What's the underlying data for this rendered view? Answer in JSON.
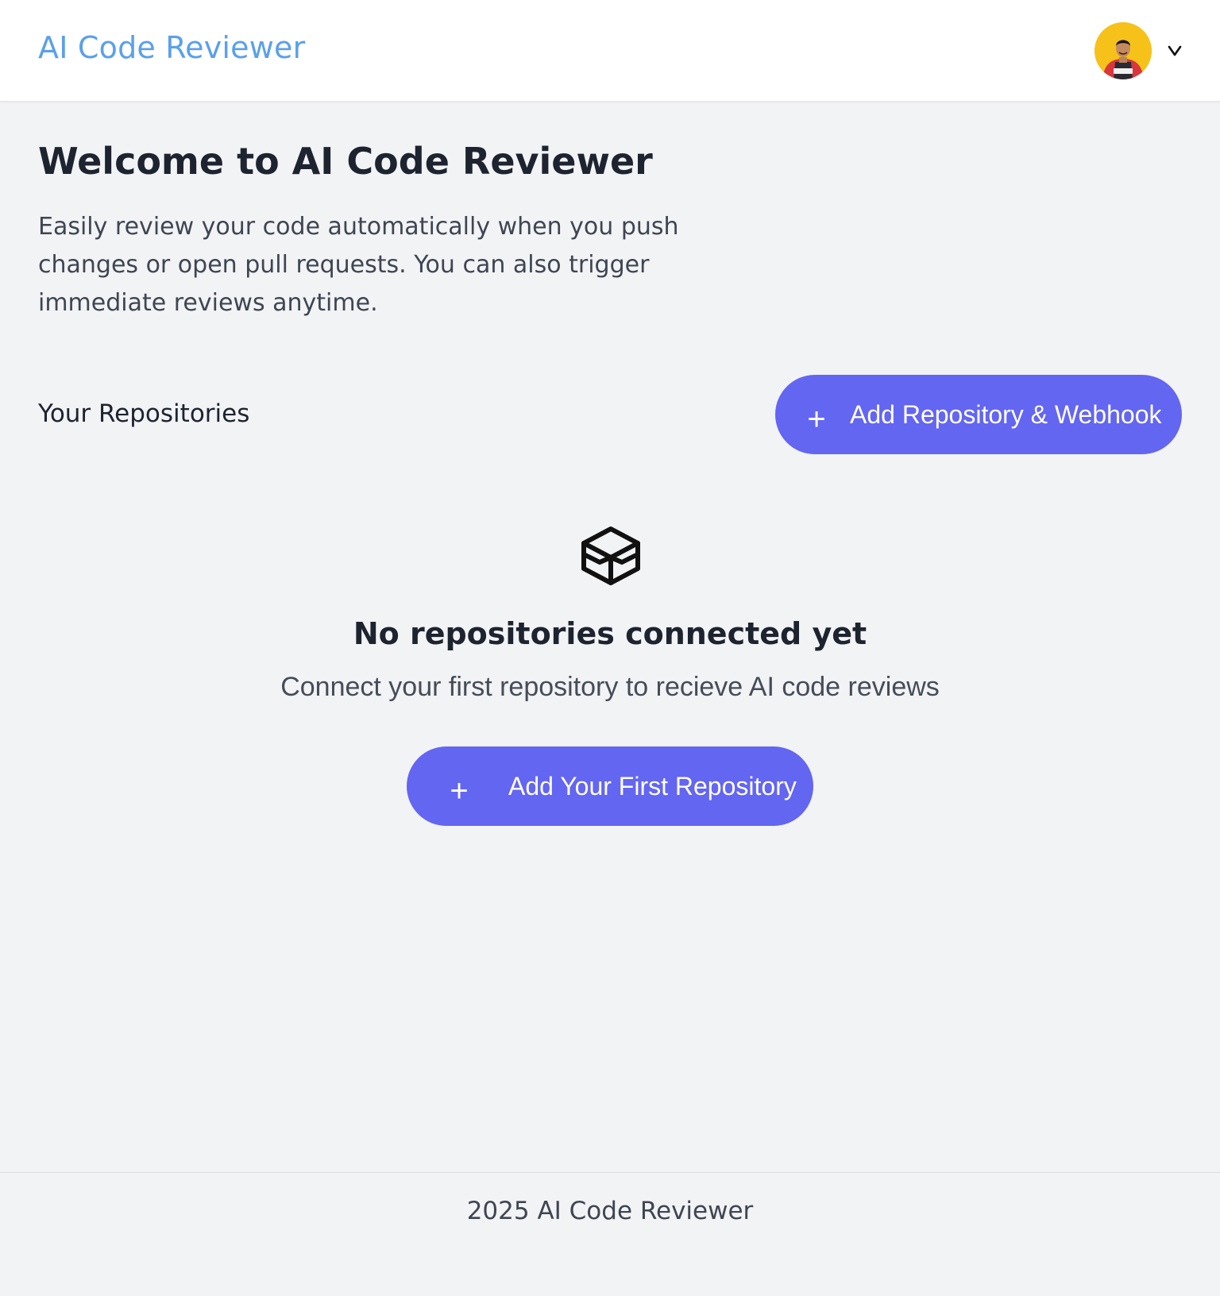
{
  "header": {
    "brand": "AI Code Reviewer",
    "user_menu": {
      "avatar_icon": "user-avatar",
      "chevron_icon": "chevron-down-icon",
      "chevron_text": "v"
    }
  },
  "welcome": {
    "title": "Welcome to AI Code Reviewer",
    "description": "Easily review your code automatically when you push changes or open pull requests. You can also trigger immediate reviews anytime."
  },
  "repositories": {
    "section_label": "Your Repositories",
    "add_button": {
      "icon": "plus",
      "plus_glyph": "+",
      "label": "Add Repository & Webhook"
    }
  },
  "empty_state": {
    "icon": "box-icon",
    "title": "No repositories connected yet",
    "description": "Connect your first repository to recieve AI code reviews",
    "button": {
      "icon": "plus",
      "plus_glyph": "+",
      "label": "Add Your First Repository"
    }
  },
  "footer": {
    "text": "2025 AI Code Reviewer"
  },
  "colors": {
    "brand": "#5ba0ea",
    "primary_button": "#6366f1",
    "background": "#f2f3f5",
    "header_background": "#ffffff",
    "avatar_background": "#f6c21a"
  }
}
